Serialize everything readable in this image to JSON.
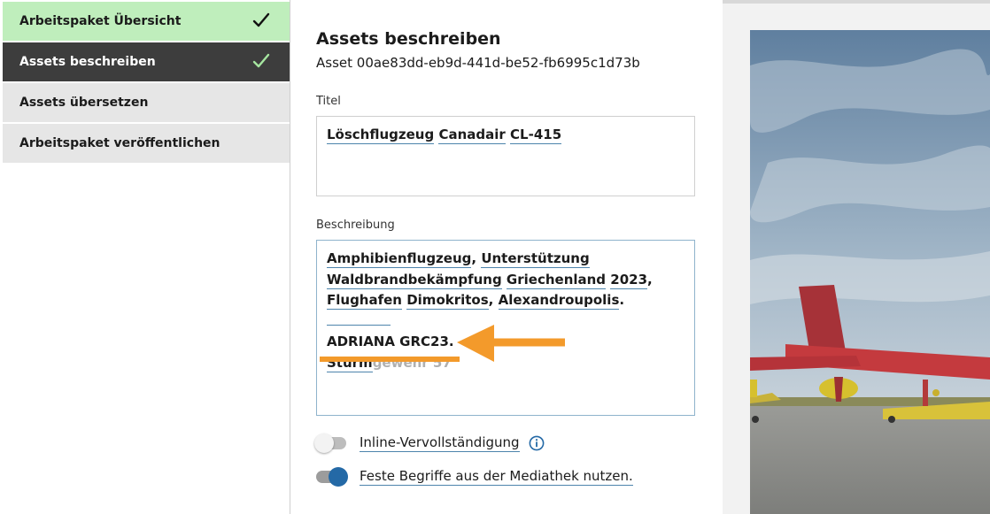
{
  "sidebar": {
    "steps": [
      {
        "label": "Arbeitspaket Übersicht",
        "state": "done"
      },
      {
        "label": "Assets beschreiben",
        "state": "active-done"
      },
      {
        "label": "Assets übersetzen",
        "state": "pending"
      },
      {
        "label": "Arbeitspaket veröffentlichen",
        "state": "pending"
      }
    ]
  },
  "main": {
    "title": "Assets beschreiben",
    "asset_id": "Asset 00ae83dd-eb9d-441d-be52-fb6995c1d73b",
    "title_field": {
      "label": "Titel",
      "words": [
        "Löschflugzeug",
        "Canadair",
        "CL-415"
      ]
    },
    "description_field": {
      "label": "Beschreibung",
      "line1": {
        "w1": "Amphibienflugzeug",
        "sep1": ", ",
        "w2": "Unterstützung"
      },
      "line2": {
        "w1": "Waldbrandbekämpfung",
        "w2": "Griechenland",
        "w3": "2023",
        "sep": ","
      },
      "line3": {
        "w1": "Flughafen",
        "w2": "Dimokritos",
        "sep1": ", ",
        "w3": "Alexandroupolis",
        "sep2": "."
      },
      "line4": "ADRIANA GRC23.",
      "line5": {
        "typed": "Sturm",
        "suggestion": "gewehr 57"
      }
    },
    "toggles": [
      {
        "label": "Inline-Vervollständigung",
        "on": false
      },
      {
        "label": "Feste Begriffe aus der Mediathek nutzen.",
        "on": true
      }
    ]
  },
  "colors": {
    "accent": "#2469a6",
    "done_step": "#bfeebc",
    "active_step": "#3d3d3d",
    "annotation": "#f39a2b"
  },
  "icons": [
    "checkmark-icon",
    "info-icon",
    "arrow-left-icon"
  ]
}
